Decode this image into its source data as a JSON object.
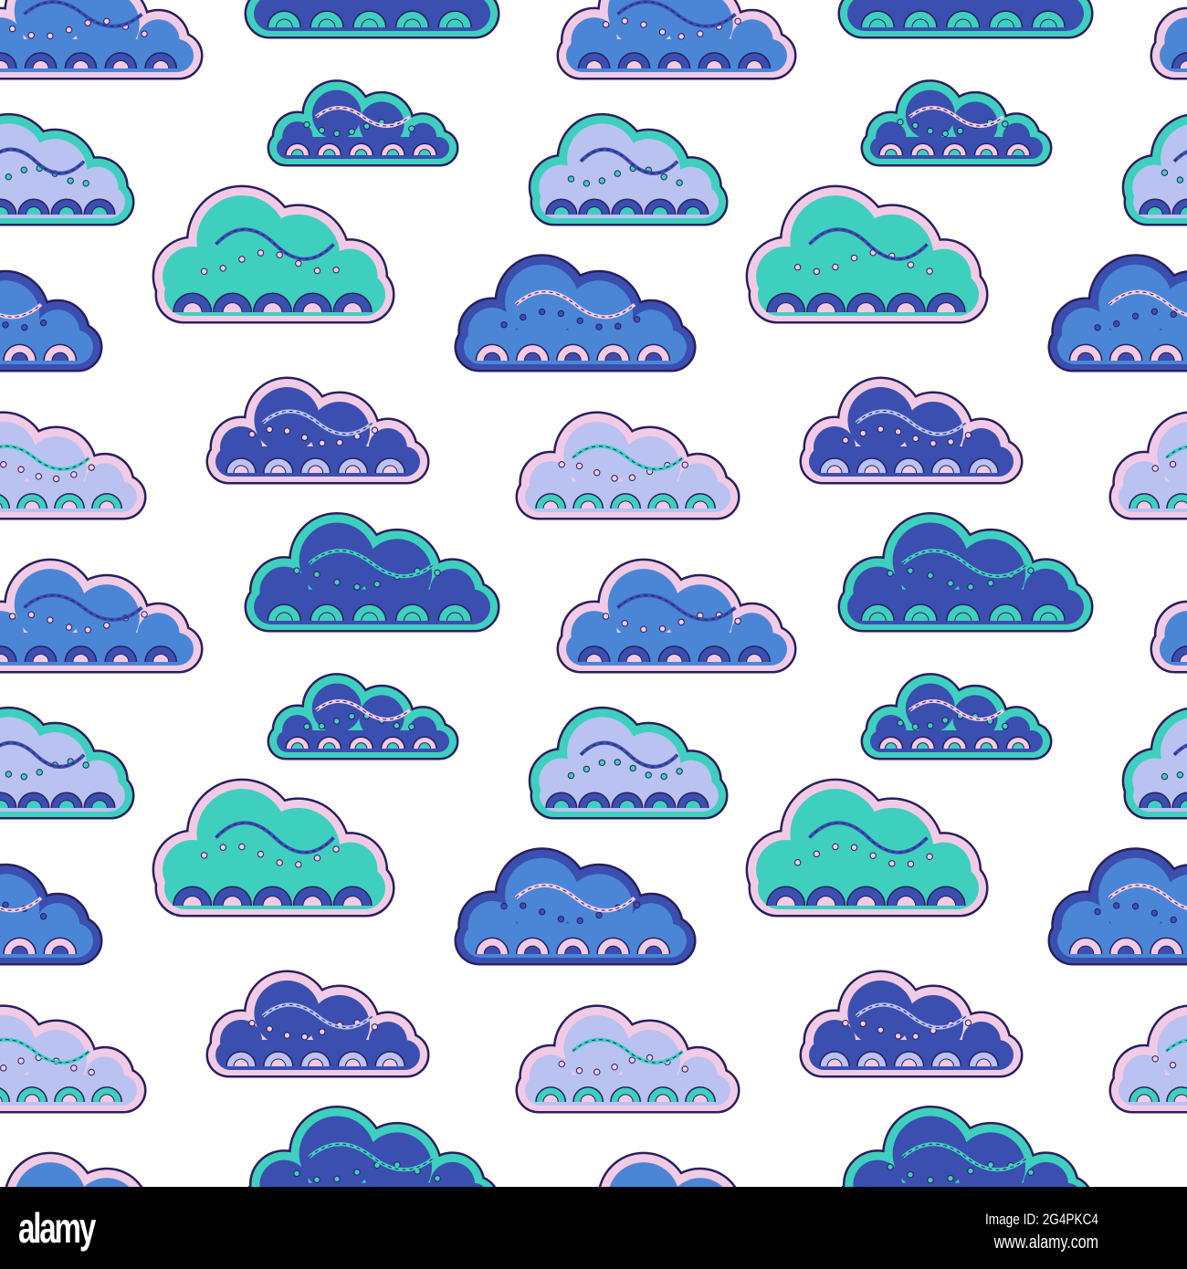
{
  "pattern": {
    "subject": "seamless doodle clouds",
    "colors": {
      "blue": "#4b86d6",
      "navy": "#3a4fb0",
      "teal": "#3fcfbf",
      "pink": "#f1cbe6",
      "lilac": "#b9c2f0",
      "outline": "#2a1f5c",
      "background": "#ffffff"
    }
  },
  "watermark": {
    "logo": "alamy",
    "image_id": "Image ID: 2G4PKC4",
    "site": "www.alamy.com"
  }
}
